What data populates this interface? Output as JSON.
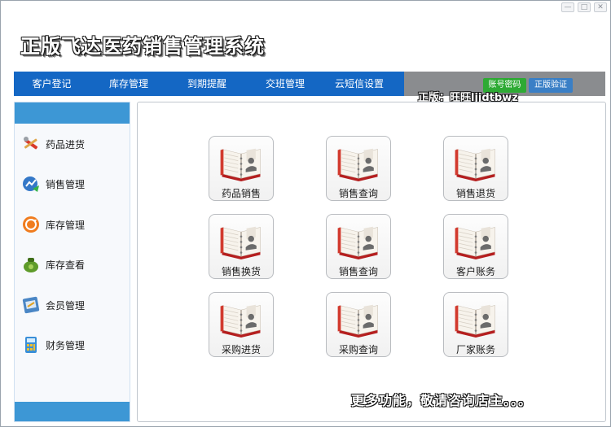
{
  "window": {
    "controls": [
      "—",
      "□",
      "✕"
    ]
  },
  "app": {
    "title": "正版飞达医药销售管理系统"
  },
  "menu": {
    "items": [
      "客户登记",
      "库存管理",
      "到期提醒",
      "交班管理",
      "云短信设置"
    ],
    "account_button": "账号密码",
    "verify_button": "正版验证",
    "version_text": "正版：旺旺ljjdtbwz"
  },
  "sidebar": {
    "items": [
      {
        "label": "药品进货",
        "icon": "tools-icon"
      },
      {
        "label": "销售管理",
        "icon": "chart-refresh-icon"
      },
      {
        "label": "库存管理",
        "icon": "orange-cycle-icon"
      },
      {
        "label": "库存查看",
        "icon": "green-bag-icon"
      },
      {
        "label": "会员管理",
        "icon": "member-card-icon"
      },
      {
        "label": "财务管理",
        "icon": "calculator-icon"
      }
    ]
  },
  "tiles": [
    {
      "label": "药品销售",
      "icon": "address-book-icon"
    },
    {
      "label": "销售查询",
      "icon": "address-book-icon"
    },
    {
      "label": "销售退货",
      "icon": "address-book-icon"
    },
    {
      "label": "销售换货",
      "icon": "address-book-icon"
    },
    {
      "label": "销售查询",
      "icon": "address-book-icon"
    },
    {
      "label": "客户账务",
      "icon": "address-book-icon"
    },
    {
      "label": "采购进货",
      "icon": "address-book-icon"
    },
    {
      "label": "采购查询",
      "icon": "address-book-icon"
    },
    {
      "label": "厂家账务",
      "icon": "address-book-icon"
    }
  ],
  "footer": {
    "more_text": "更多功能，敬请咨询店主。。。"
  },
  "colors": {
    "menu_bar": "#1467c4",
    "sidebar_band": "#3d97d5",
    "account_button": "#2eaa34",
    "verify_button": "#3a7fc6"
  }
}
